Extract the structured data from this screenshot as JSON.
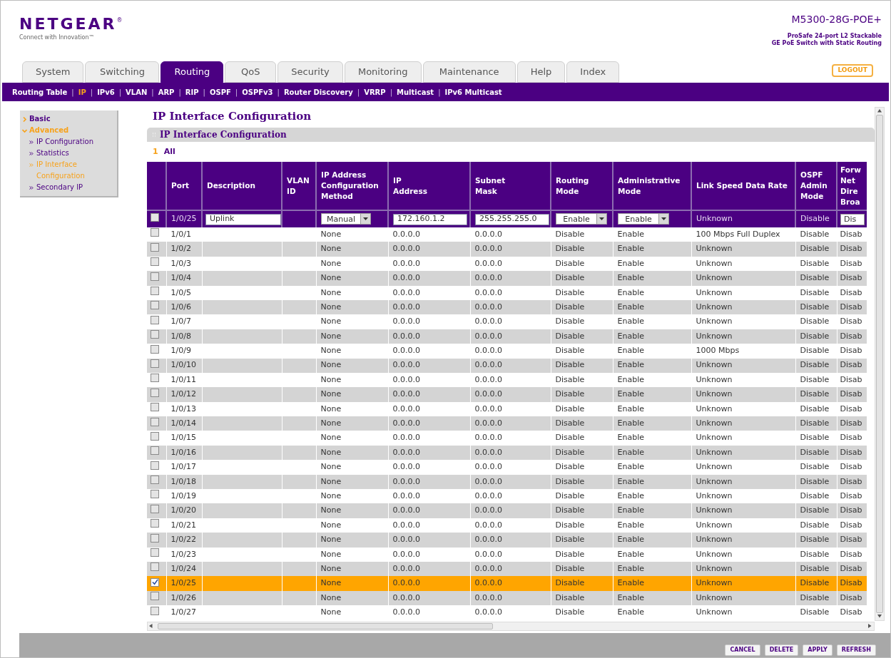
{
  "header": {
    "logo": "NETGEAR",
    "logo_mark": "®",
    "tagline": "Connect with Innovation™",
    "model": "M5300-28G-POE+",
    "model_desc": [
      "ProSafe 24-port L2 Stackable",
      "GE PoE Switch with Static Routing"
    ],
    "logout": "LOGOUT"
  },
  "tabs": [
    {
      "label": "System",
      "selected": false
    },
    {
      "label": "Switching",
      "selected": false
    },
    {
      "label": "Routing",
      "selected": true
    },
    {
      "label": "QoS",
      "selected": false
    },
    {
      "label": "Security",
      "selected": false
    },
    {
      "label": "Monitoring",
      "selected": false
    },
    {
      "label": "Maintenance",
      "selected": false
    },
    {
      "label": "Help",
      "selected": false
    },
    {
      "label": "Index",
      "selected": false
    }
  ],
  "submenu": {
    "separator": "|",
    "items": [
      {
        "label": "Routing Table",
        "selected": false
      },
      {
        "label": "IP",
        "selected": true
      },
      {
        "label": "IPv6",
        "selected": false
      },
      {
        "label": "VLAN",
        "selected": false
      },
      {
        "label": "ARP",
        "selected": false
      },
      {
        "label": "RIP",
        "selected": false
      },
      {
        "label": "OSPF",
        "selected": false
      },
      {
        "label": "OSPFv3",
        "selected": false
      },
      {
        "label": "Router Discovery",
        "selected": false
      },
      {
        "label": "VRRP",
        "selected": false
      },
      {
        "label": "Multicast",
        "selected": false
      },
      {
        "label": "IPv6 Multicast",
        "selected": false
      }
    ]
  },
  "sidebar": {
    "items": [
      {
        "label": "Basic",
        "expanded": false
      },
      {
        "label": "Advanced",
        "expanded": true,
        "children": [
          {
            "label": "IP Configuration",
            "selected": false
          },
          {
            "label": "Statistics",
            "selected": false
          },
          {
            "label": "IP Interface Configuration",
            "selected": true
          },
          {
            "label": "Secondary IP",
            "selected": false
          }
        ]
      }
    ]
  },
  "page_title": "IP Interface Configuration",
  "section_title": "IP Interface Configuration",
  "unit": {
    "number": "1",
    "label": "All"
  },
  "table": {
    "columns": [
      {
        "lines": [
          "Port"
        ]
      },
      {
        "lines": [
          "Description"
        ]
      },
      {
        "lines": [
          "VLAN",
          "ID"
        ]
      },
      {
        "lines": [
          "IP Address",
          "Configuration",
          "Method"
        ]
      },
      {
        "lines": [
          "IP",
          "Address"
        ]
      },
      {
        "lines": [
          "Subnet",
          "Mask"
        ]
      },
      {
        "lines": [
          "Routing",
          "Mode"
        ]
      },
      {
        "lines": [
          "Administrative",
          "Mode"
        ]
      },
      {
        "lines": [
          "Link Speed Data Rate"
        ]
      },
      {
        "lines": [
          "OSPF",
          "Admin",
          "Mode"
        ]
      },
      {
        "lines": [
          "Forw",
          "Net",
          "Dire",
          "Broa"
        ]
      }
    ],
    "edit_row": {
      "checked": false,
      "port": "1/0/25",
      "description": "Uplink",
      "method": "Manual",
      "ip": "172.160.1.2",
      "mask": "255.255.255.0",
      "routing": "Enable",
      "admin": "Enable",
      "link": "Unknown",
      "ospf": "Disable",
      "forward": "Dis"
    },
    "rows": [
      {
        "checked": false,
        "port": "1/0/1",
        "method": "None",
        "ip": "0.0.0.0",
        "mask": "0.0.0.0",
        "routing": "Disable",
        "admin": "Enable",
        "link": "100 Mbps Full Duplex",
        "ospf": "Disable",
        "forward": "Disab"
      },
      {
        "checked": false,
        "port": "1/0/2",
        "method": "None",
        "ip": "0.0.0.0",
        "mask": "0.0.0.0",
        "routing": "Disable",
        "admin": "Enable",
        "link": "Unknown",
        "ospf": "Disable",
        "forward": "Disab"
      },
      {
        "checked": false,
        "port": "1/0/3",
        "method": "None",
        "ip": "0.0.0.0",
        "mask": "0.0.0.0",
        "routing": "Disable",
        "admin": "Enable",
        "link": "Unknown",
        "ospf": "Disable",
        "forward": "Disab"
      },
      {
        "checked": false,
        "port": "1/0/4",
        "method": "None",
        "ip": "0.0.0.0",
        "mask": "0.0.0.0",
        "routing": "Disable",
        "admin": "Enable",
        "link": "Unknown",
        "ospf": "Disable",
        "forward": "Disab"
      },
      {
        "checked": false,
        "port": "1/0/5",
        "method": "None",
        "ip": "0.0.0.0",
        "mask": "0.0.0.0",
        "routing": "Disable",
        "admin": "Enable",
        "link": "Unknown",
        "ospf": "Disable",
        "forward": "Disab"
      },
      {
        "checked": false,
        "port": "1/0/6",
        "method": "None",
        "ip": "0.0.0.0",
        "mask": "0.0.0.0",
        "routing": "Disable",
        "admin": "Enable",
        "link": "Unknown",
        "ospf": "Disable",
        "forward": "Disab"
      },
      {
        "checked": false,
        "port": "1/0/7",
        "method": "None",
        "ip": "0.0.0.0",
        "mask": "0.0.0.0",
        "routing": "Disable",
        "admin": "Enable",
        "link": "Unknown",
        "ospf": "Disable",
        "forward": "Disab"
      },
      {
        "checked": false,
        "port": "1/0/8",
        "method": "None",
        "ip": "0.0.0.0",
        "mask": "0.0.0.0",
        "routing": "Disable",
        "admin": "Enable",
        "link": "Unknown",
        "ospf": "Disable",
        "forward": "Disab"
      },
      {
        "checked": false,
        "port": "1/0/9",
        "method": "None",
        "ip": "0.0.0.0",
        "mask": "0.0.0.0",
        "routing": "Disable",
        "admin": "Enable",
        "link": "1000 Mbps",
        "ospf": "Disable",
        "forward": "Disab"
      },
      {
        "checked": false,
        "port": "1/0/10",
        "method": "None",
        "ip": "0.0.0.0",
        "mask": "0.0.0.0",
        "routing": "Disable",
        "admin": "Enable",
        "link": "Unknown",
        "ospf": "Disable",
        "forward": "Disab"
      },
      {
        "checked": false,
        "port": "1/0/11",
        "method": "None",
        "ip": "0.0.0.0",
        "mask": "0.0.0.0",
        "routing": "Disable",
        "admin": "Enable",
        "link": "Unknown",
        "ospf": "Disable",
        "forward": "Disab"
      },
      {
        "checked": false,
        "port": "1/0/12",
        "method": "None",
        "ip": "0.0.0.0",
        "mask": "0.0.0.0",
        "routing": "Disable",
        "admin": "Enable",
        "link": "Unknown",
        "ospf": "Disable",
        "forward": "Disab"
      },
      {
        "checked": false,
        "port": "1/0/13",
        "method": "None",
        "ip": "0.0.0.0",
        "mask": "0.0.0.0",
        "routing": "Disable",
        "admin": "Enable",
        "link": "Unknown",
        "ospf": "Disable",
        "forward": "Disab"
      },
      {
        "checked": false,
        "port": "1/0/14",
        "method": "None",
        "ip": "0.0.0.0",
        "mask": "0.0.0.0",
        "routing": "Disable",
        "admin": "Enable",
        "link": "Unknown",
        "ospf": "Disable",
        "forward": "Disab"
      },
      {
        "checked": false,
        "port": "1/0/15",
        "method": "None",
        "ip": "0.0.0.0",
        "mask": "0.0.0.0",
        "routing": "Disable",
        "admin": "Enable",
        "link": "Unknown",
        "ospf": "Disable",
        "forward": "Disab"
      },
      {
        "checked": false,
        "port": "1/0/16",
        "method": "None",
        "ip": "0.0.0.0",
        "mask": "0.0.0.0",
        "routing": "Disable",
        "admin": "Enable",
        "link": "Unknown",
        "ospf": "Disable",
        "forward": "Disab"
      },
      {
        "checked": false,
        "port": "1/0/17",
        "method": "None",
        "ip": "0.0.0.0",
        "mask": "0.0.0.0",
        "routing": "Disable",
        "admin": "Enable",
        "link": "Unknown",
        "ospf": "Disable",
        "forward": "Disab"
      },
      {
        "checked": false,
        "port": "1/0/18",
        "method": "None",
        "ip": "0.0.0.0",
        "mask": "0.0.0.0",
        "routing": "Disable",
        "admin": "Enable",
        "link": "Unknown",
        "ospf": "Disable",
        "forward": "Disab"
      },
      {
        "checked": false,
        "port": "1/0/19",
        "method": "None",
        "ip": "0.0.0.0",
        "mask": "0.0.0.0",
        "routing": "Disable",
        "admin": "Enable",
        "link": "Unknown",
        "ospf": "Disable",
        "forward": "Disab"
      },
      {
        "checked": false,
        "port": "1/0/20",
        "method": "None",
        "ip": "0.0.0.0",
        "mask": "0.0.0.0",
        "routing": "Disable",
        "admin": "Enable",
        "link": "Unknown",
        "ospf": "Disable",
        "forward": "Disab"
      },
      {
        "checked": false,
        "port": "1/0/21",
        "method": "None",
        "ip": "0.0.0.0",
        "mask": "0.0.0.0",
        "routing": "Disable",
        "admin": "Enable",
        "link": "Unknown",
        "ospf": "Disable",
        "forward": "Disab"
      },
      {
        "checked": false,
        "port": "1/0/22",
        "method": "None",
        "ip": "0.0.0.0",
        "mask": "0.0.0.0",
        "routing": "Disable",
        "admin": "Enable",
        "link": "Unknown",
        "ospf": "Disable",
        "forward": "Disab"
      },
      {
        "checked": false,
        "port": "1/0/23",
        "method": "None",
        "ip": "0.0.0.0",
        "mask": "0.0.0.0",
        "routing": "Disable",
        "admin": "Enable",
        "link": "Unknown",
        "ospf": "Disable",
        "forward": "Disab"
      },
      {
        "checked": false,
        "port": "1/0/24",
        "method": "None",
        "ip": "0.0.0.0",
        "mask": "0.0.0.0",
        "routing": "Disable",
        "admin": "Enable",
        "link": "Unknown",
        "ospf": "Disable",
        "forward": "Disab"
      },
      {
        "checked": true,
        "port": "1/0/25",
        "method": "None",
        "ip": "0.0.0.0",
        "mask": "0.0.0.0",
        "routing": "Disable",
        "admin": "Enable",
        "link": "Unknown",
        "ospf": "Disable",
        "forward": "Disab"
      },
      {
        "checked": false,
        "port": "1/0/26",
        "method": "None",
        "ip": "0.0.0.0",
        "mask": "0.0.0.0",
        "routing": "Disable",
        "admin": "Enable",
        "link": "Unknown",
        "ospf": "Disable",
        "forward": "Disab"
      },
      {
        "checked": false,
        "port": "1/0/27",
        "method": "None",
        "ip": "0.0.0.0",
        "mask": "0.0.0.0",
        "routing": "Disable",
        "admin": "Enable",
        "link": "Unknown",
        "ospf": "Disable",
        "forward": "Disab"
      }
    ]
  },
  "buttons": [
    "CANCEL",
    "DELETE",
    "APPLY",
    "REFRESH"
  ]
}
